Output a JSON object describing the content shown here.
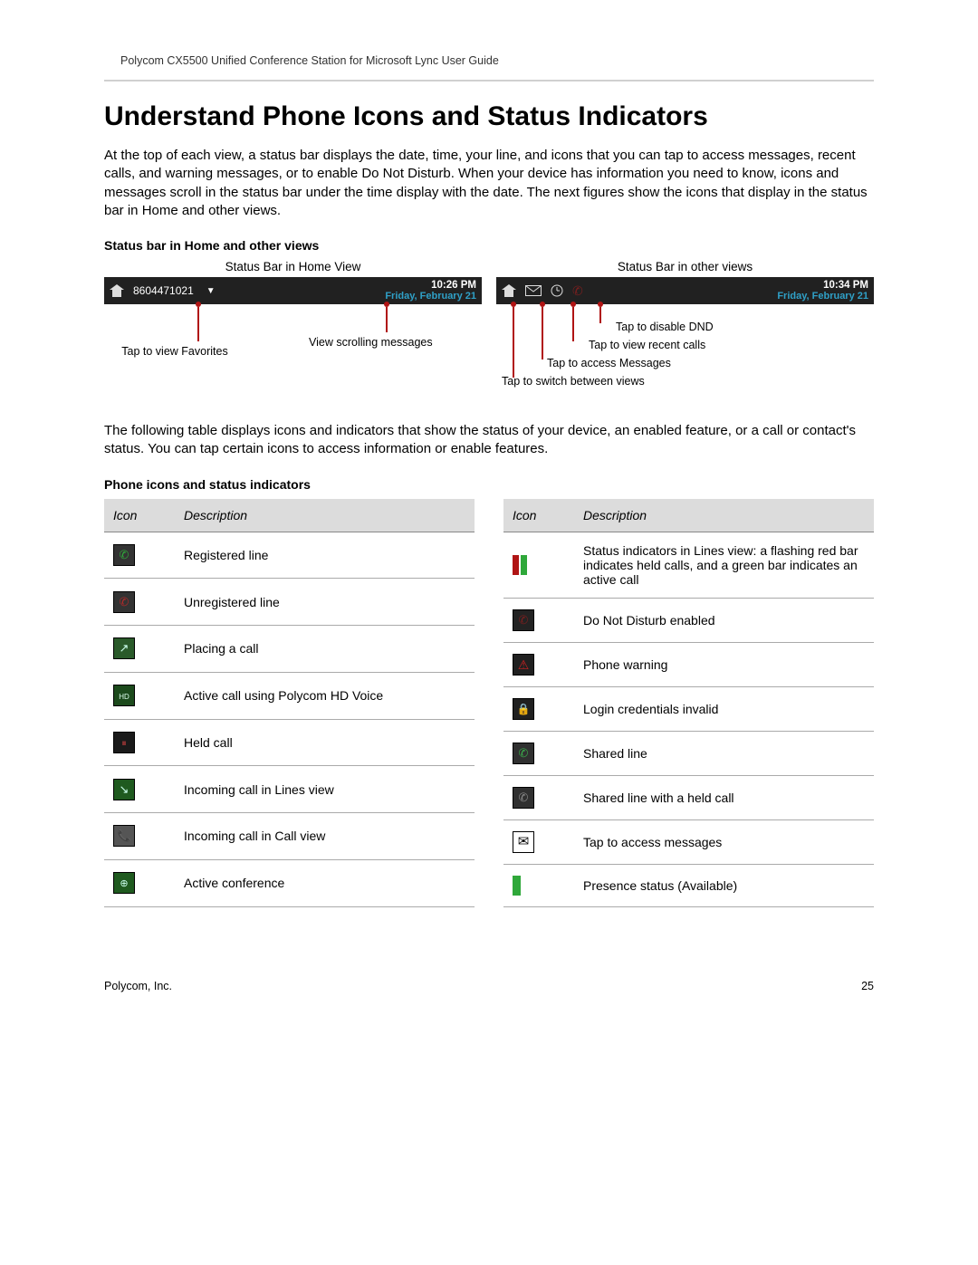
{
  "header": "Polycom CX5500 Unified Conference Station for Microsoft Lync User Guide",
  "title": "Understand Phone Icons and Status Indicators",
  "intro": "At the top of each view, a status bar displays the date, time, your line, and icons that you can tap to access messages, recent calls, and warning messages, or to enable Do Not Disturb. When your device has information you need to know, icons and messages scroll in the status bar under the time display with the date. The next figures show the icons that display in the status bar in Home and other views.",
  "figure_caption": "Status bar in Home and other views",
  "figure": {
    "home": {
      "label": "Status Bar in Home View",
      "line": "8604471021",
      "time": "10:26 PM",
      "date": "Friday, February 21",
      "callouts": {
        "favorites": "Tap to view Favorites",
        "scrolling": "View scrolling messages"
      }
    },
    "other": {
      "label": "Status Bar in other views",
      "time": "10:34 PM",
      "date": "Friday, February 21",
      "callouts": {
        "dnd": "Tap to disable DND",
        "recent": "Tap to view recent calls",
        "messages": "Tap to access Messages",
        "switch": "Tap to switch between views"
      }
    }
  },
  "mid_text": "The following table displays icons and indicators that show the status of your device, an enabled feature, or a call or contact's status. You can tap certain icons to access information or enable features.",
  "table_caption": "Phone icons and status indicators",
  "col_headers": {
    "icon": "Icon",
    "desc": "Description"
  },
  "left_rows": [
    {
      "id": "green-phone",
      "desc": "Registered line"
    },
    {
      "id": "red-phone",
      "desc": "Unregistered line"
    },
    {
      "id": "placing",
      "desc": "Placing a call"
    },
    {
      "id": "hd",
      "desc": "Active call using Polycom HD Voice"
    },
    {
      "id": "held",
      "desc": "Held call"
    },
    {
      "id": "inclines",
      "desc": "Incoming call in Lines view"
    },
    {
      "id": "incall",
      "desc": "Incoming call in Call view"
    },
    {
      "id": "conf",
      "desc": "Active conference"
    }
  ],
  "right_rows": [
    {
      "id": "bars",
      "desc": "Status indicators in Lines view: a flashing red bar indicates held calls, and a green bar indicates an active call"
    },
    {
      "id": "dnd",
      "desc": "Do Not Disturb enabled"
    },
    {
      "id": "warn",
      "desc": "Phone warning"
    },
    {
      "id": "lock",
      "desc": "Login credentials invalid"
    },
    {
      "id": "shared",
      "desc": "Shared line"
    },
    {
      "id": "sharedheld",
      "desc": "Shared line with a held call"
    },
    {
      "id": "msg",
      "desc": "Tap to access messages"
    },
    {
      "id": "pbar",
      "desc": "Presence status (Available)"
    }
  ],
  "footer": {
    "left": "Polycom, Inc.",
    "right": "25"
  }
}
